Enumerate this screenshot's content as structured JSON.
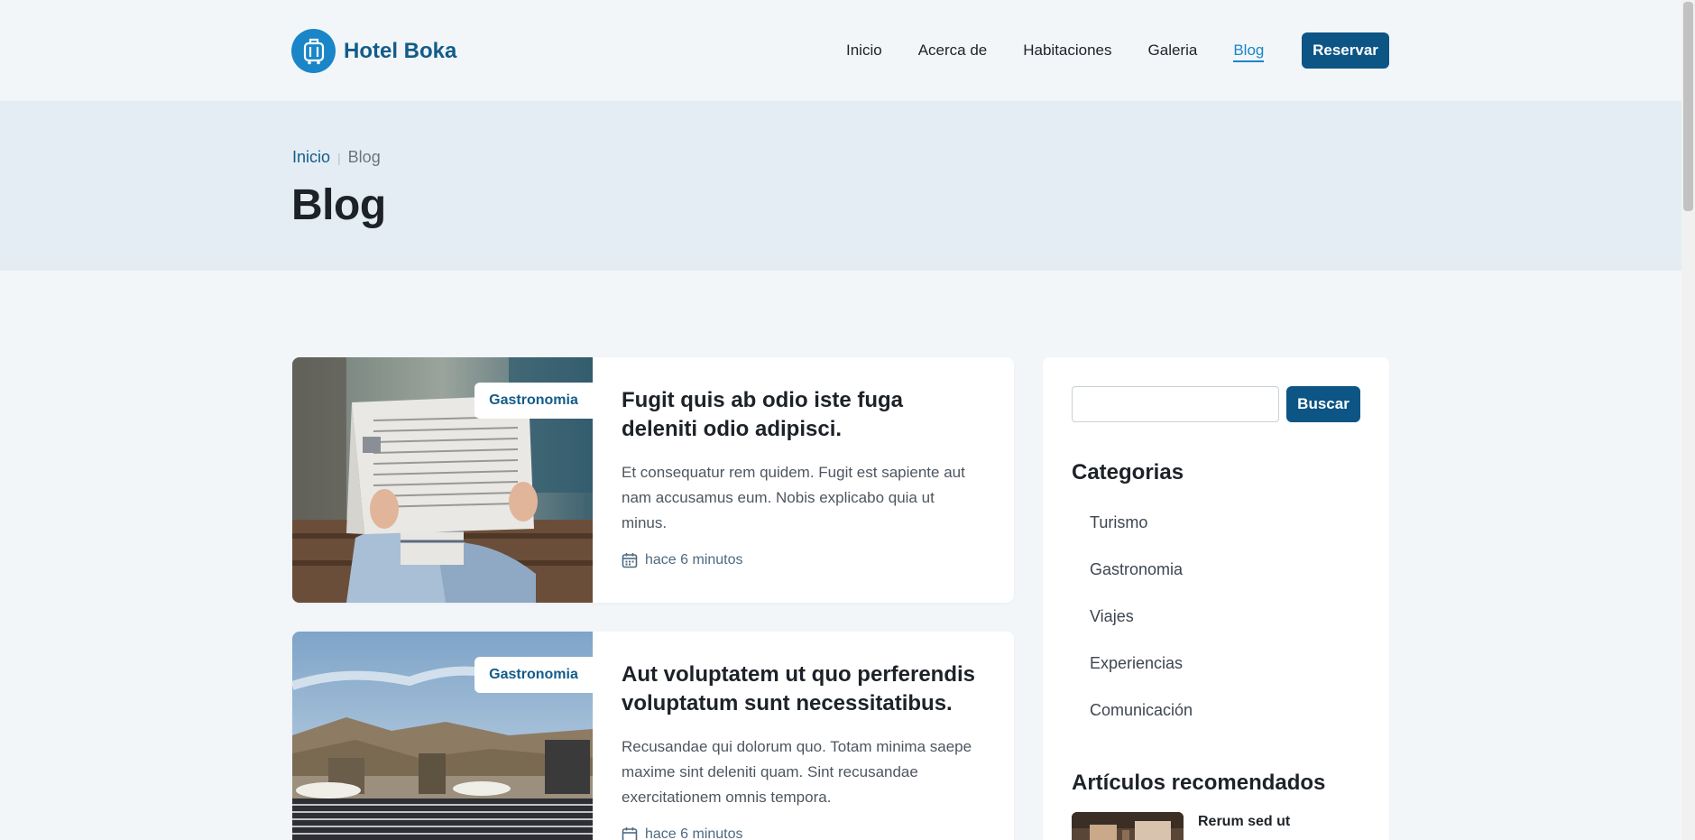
{
  "header": {
    "brand": "Hotel Boka",
    "nav": [
      {
        "label": "Inicio",
        "active": false
      },
      {
        "label": "Acerca de",
        "active": false
      },
      {
        "label": "Habitaciones",
        "active": false
      },
      {
        "label": "Galeria",
        "active": false
      },
      {
        "label": "Blog",
        "active": true
      }
    ],
    "reserve_label": "Reservar"
  },
  "hero": {
    "breadcrumb": {
      "home": "Inicio",
      "current": "Blog"
    },
    "title": "Blog"
  },
  "posts": [
    {
      "category": "Gastronomia",
      "title": "Fugit quis ab odio iste fuga deleniti odio adipisci.",
      "excerpt": "Et consequatur rem quidem. Fugit est sapiente aut nam accusamus eum. Nobis explicabo quia ut minus.",
      "date": "hace 6 minutos"
    },
    {
      "category": "Gastronomia",
      "title": "Aut voluptatem ut quo perferendis voluptatum sunt necessitatibus.",
      "excerpt": "Recusandae qui dolorum quo. Totam minima saepe maxime sint deleniti quam. Sint recusandae exercitationem omnis tempora.",
      "date": "hace 6 minutos"
    }
  ],
  "sidebar": {
    "search_placeholder": "",
    "search_label": "Buscar",
    "categories_heading": "Categorias",
    "categories": [
      "Turismo",
      "Gastronomia",
      "Viajes",
      "Experiencias",
      "Comunicación"
    ],
    "recommended_heading": "Artículos recomendados",
    "recommended": [
      {
        "title": "Rerum sed ut"
      }
    ]
  },
  "colors": {
    "accent": "#1a86c7",
    "brand_dark": "#0c5585",
    "page_bg": "#f2f6f9",
    "hero_bg": "#e5edf4"
  }
}
